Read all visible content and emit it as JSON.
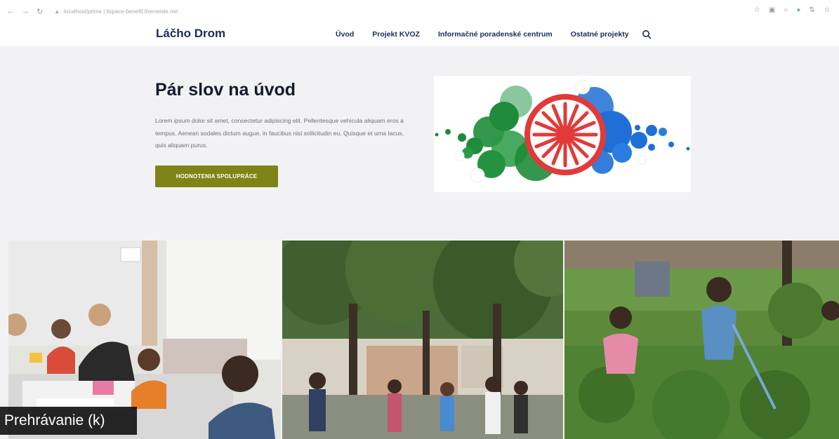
{
  "browser": {
    "url": "localhost/prime | itspace-benefit.themeisle.net",
    "back_icon": "arrow-left-icon",
    "forward_icon": "arrow-right-icon",
    "reload_icon": "reload-icon"
  },
  "header": {
    "logo": "Láčho Drom",
    "nav": [
      "Úvod",
      "Projekt KVOZ",
      "Informačné poradenské centrum",
      "Ostatné projekty"
    ],
    "search_icon": "search-icon"
  },
  "hero": {
    "title": "Pár slov na úvod",
    "text": "Lorem ipsum dolor sit amet, consectetur adipiscing elit. Pellentesque vehicula aliquam eros a tempus. Aenean sodales dictum augue, in faucibus nisi sollicitudin eu. Quisque et urna lacus, quis aliquam purus.",
    "cta_label": "HODNOTENIA SPOLUPRÁCE"
  },
  "photos": [
    {
      "name": "photo-children-classroom"
    },
    {
      "name": "photo-outdoor-gathering"
    },
    {
      "name": "photo-garden-work"
    }
  ],
  "caption": "Prehrávanie (k)",
  "colors": {
    "brand_navy": "#1d2a5b",
    "cta_olive": "#7e8416",
    "flag_green": "#1e8c3a",
    "flag_blue": "#1f6fd6",
    "flag_red": "#e23a3a"
  }
}
